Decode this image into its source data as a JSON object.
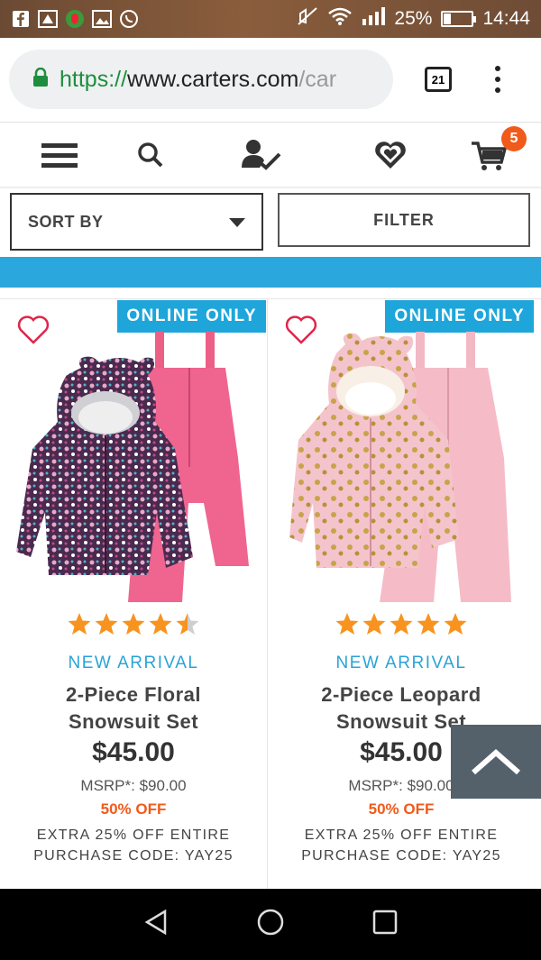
{
  "status_bar": {
    "battery": "25%",
    "battery_level": 0.25,
    "time": "14:44",
    "icons": [
      "facebook-icon",
      "warning-icon",
      "shield-icon",
      "gallery-icon",
      "whatsapp-icon",
      "mute-icon",
      "wifi-icon",
      "signal-icon",
      "battery-icon"
    ]
  },
  "browser": {
    "url_scheme": "https://",
    "url_host": "www.carters.com",
    "url_path_fade": "/car",
    "tab_count": "21"
  },
  "site_nav": {
    "icons": [
      "menu-icon",
      "search-icon",
      "account-icon",
      "wishlist-heart-icon",
      "cart-icon"
    ],
    "cart_count": "5"
  },
  "sort_label": "SORT BY",
  "filter_label": "FILTER",
  "products": [
    {
      "badge": "ONLINE ONLY",
      "rating": 4.5,
      "tag": "NEW ARRIVAL",
      "title_line1": "2-Piece Floral",
      "title_line2": "Snowsuit Set",
      "price": "$45.00",
      "msrp": "MSRP*: $90.00",
      "discount": "50% OFF",
      "promo_line1": "EXTRA 25% OFF ENTIRE",
      "promo_line2": "PURCHASE CODE: YAY25"
    },
    {
      "badge": "ONLINE ONLY",
      "rating": 5,
      "tag": "NEW ARRIVAL",
      "title_line1": "2-Piece Leopard",
      "title_line2": "Snowsuit Set",
      "price": "$45.00",
      "msrp": "MSRP*: $90.00",
      "discount": "50% OFF",
      "promo_line1": "EXTRA 25% OFF ENTIRE",
      "promo_line2": "PURCHASE CODE: YAY25"
    }
  ],
  "colors": {
    "accent_blue": "#2aa7dc",
    "discount_orange": "#f05a1a",
    "star_orange": "#f7931e"
  }
}
